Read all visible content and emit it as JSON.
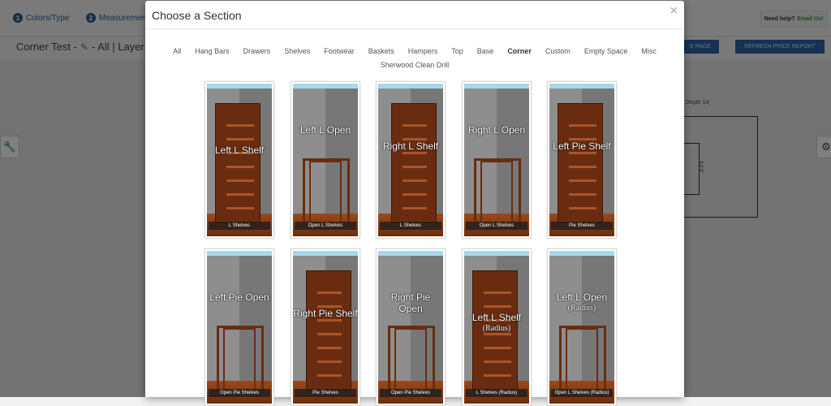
{
  "app": {
    "steps": [
      {
        "num": "1",
        "label": "Colors/Type"
      },
      {
        "num": "2",
        "label": "Measurement"
      }
    ],
    "help_text": "Need help?",
    "help_link": "Email Us!",
    "project_title": "Corner Test -",
    "project_suffix": "- All | Layer",
    "buttons": {
      "page_btn": "E PAGE",
      "refresh_price": "REFRESH PRICE REPORT"
    },
    "plan": {
      "depth_label": "Depth 14;",
      "dimension": "3 ft 0\""
    }
  },
  "modal": {
    "title": "Choose a Section",
    "close_label": "×",
    "active_filter": "Corner",
    "filters_row1": [
      "All",
      "Hang Bars",
      "Drawers",
      "Shelves",
      "Footwear",
      "Baskets",
      "Hampers",
      "Top",
      "Base",
      "Corner",
      "Custom",
      "Empty Space",
      "Misc"
    ],
    "filters_row2": [
      "Sherwood Clean Drill"
    ],
    "cards": [
      {
        "title": "Left L Shelf",
        "subtitle": "",
        "caption": "L Shelves"
      },
      {
        "title": "Left L Open",
        "subtitle": "",
        "caption": "Open L Shelves"
      },
      {
        "title": "Right L Shelf",
        "subtitle": "",
        "caption": "L Shelves"
      },
      {
        "title": "Right L Open",
        "subtitle": "",
        "caption": "Open L Shelves"
      },
      {
        "title": "Left Pie Shelf",
        "subtitle": "",
        "caption": "Pie Shelves"
      },
      {
        "title": "Left Pie Open",
        "subtitle": "",
        "caption": "Open Pie Shelves"
      },
      {
        "title": "Right Pie Shelf",
        "subtitle": "",
        "caption": "Pie Shelves"
      },
      {
        "title": "Right Pie Open",
        "subtitle": "",
        "caption": "Open Pie Shelves"
      },
      {
        "title": "Left L Shelf",
        "subtitle": "(Radius)",
        "caption": "L Shelves (Radius)"
      },
      {
        "title": "Left L Open",
        "subtitle": "(Radius)",
        "caption": "Open L Shelves (Radius)"
      }
    ]
  }
}
